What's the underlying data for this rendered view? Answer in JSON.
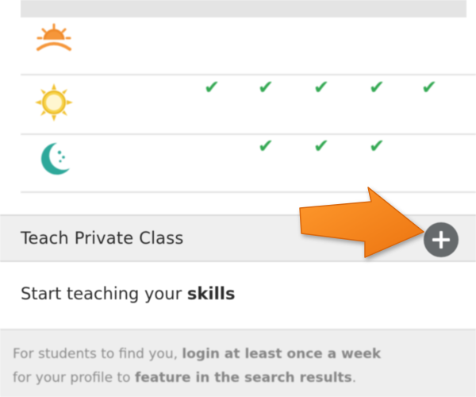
{
  "schedule": {
    "periods": [
      {
        "name": "sunrise",
        "icon": "sunrise-icon",
        "checks": [
          false,
          false,
          false,
          false,
          false
        ]
      },
      {
        "name": "day",
        "icon": "sun-icon",
        "checks": [
          true,
          true,
          true,
          true,
          true
        ]
      },
      {
        "name": "night",
        "icon": "moon-icon",
        "checks": [
          false,
          true,
          true,
          true,
          false
        ]
      }
    ],
    "check_color": "#33a852"
  },
  "teach": {
    "title": "Teach Private Class",
    "add_icon": "plus-circle-icon"
  },
  "skills": {
    "prefix": "Start teaching your ",
    "emphasis": "skills"
  },
  "notice": {
    "line1_plain": "For students to find you, ",
    "line1_bold": "login at least once a week",
    "line2_plain_a": "for your profile to ",
    "line2_bold": "feature in the search results",
    "line2_plain_b": "."
  },
  "colors": {
    "accent_orange": "#f5821f",
    "add_button_bg": "#666a6c",
    "moon_teal": "#2ea89a",
    "sun_yellow": "#f2c230"
  }
}
